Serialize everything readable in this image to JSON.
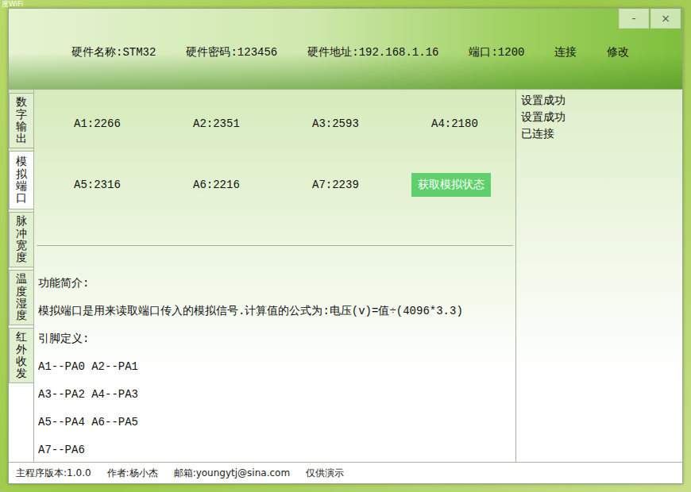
{
  "desktop": {
    "label": "度WiFi"
  },
  "window": {
    "controls": [
      "-",
      "×"
    ]
  },
  "header": {
    "fields": [
      "硬件名称:STM32",
      "硬件密码:123456",
      "硬件地址:192.168.1.16",
      "端口:1200"
    ],
    "actions": [
      "连接",
      "修改"
    ]
  },
  "tabs": [
    {
      "label": "数字输出",
      "selected": false
    },
    {
      "label": "模拟端口",
      "selected": true
    },
    {
      "label": "脉冲宽度",
      "selected": false
    },
    {
      "label": "温度湿度",
      "selected": false
    },
    {
      "label": "红外收发",
      "selected": false
    }
  ],
  "analog": {
    "readings": [
      "A1:2266",
      "A2:2351",
      "A3:2593",
      "A4:2180",
      "A5:2316",
      "A6:2216",
      "A7:2239"
    ],
    "button": "获取模拟状态"
  },
  "intro": {
    "title": "功能简介:",
    "formula": "模拟端口是用来读取端口传入的模拟信号.计算值的公式为:电压(v)=值÷(4096*3.3)",
    "pin_title": "引脚定义:",
    "pins": [
      "A1--PA0 A2--PA1",
      "A3--PA2 A4--PA3",
      "A5--PA4 A6--PA5",
      "A7--PA6"
    ]
  },
  "log": [
    "设置成功",
    "设置成功",
    "已连接"
  ],
  "status_bar": [
    "主程序版本:1.0.0",
    "作者:杨小杰",
    "邮箱:youngytj@sina.com",
    "仅供演示"
  ]
}
